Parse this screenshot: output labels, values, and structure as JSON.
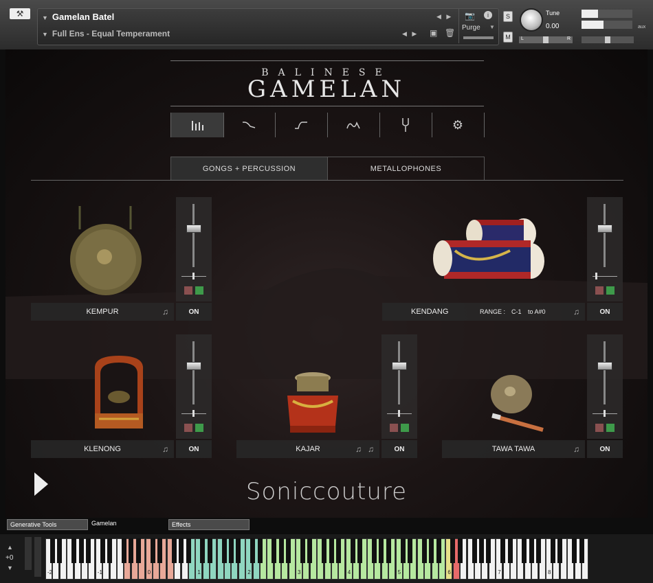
{
  "header": {
    "instrument_name": "Gamelan Batel",
    "snapshot_name": "Full Ens - Equal Temperament",
    "purge_label": "Purge",
    "tune_label": "Tune",
    "tune_value": "0.00",
    "solo_label": "S",
    "mute_label": "M",
    "pan_left": "L",
    "pan_right": "R",
    "aux_label": "aux"
  },
  "brand": {
    "subtitle": "BALINESE",
    "title": "GAMELAN",
    "logo": "Soniccouture"
  },
  "icon_tabs": [
    "mixer-icon",
    "envelope-decay-icon",
    "envelope-attack-icon",
    "eq-curve-icon",
    "tuning-fork-icon",
    "gear-icon"
  ],
  "section_tabs": [
    {
      "label": "GONGS + PERCUSSION",
      "active": true
    },
    {
      "label": "METALLOPHONES",
      "active": false
    }
  ],
  "instruments": [
    {
      "label": "KEMPUR",
      "on": "ON",
      "fader": 0.62
    },
    {
      "label": "KENDANG",
      "on": "ON",
      "fader": 0.62,
      "range_label": "RANGE :",
      "range_from": "C-1",
      "range_to": "to A#0"
    },
    {
      "label": "KLENONG",
      "on": "ON",
      "fader": 0.62
    },
    {
      "label": "KAJAR",
      "on": "ON",
      "fader": 0.62
    },
    {
      "label": "TAWA TAWA",
      "on": "ON",
      "fader": 0.62
    }
  ],
  "bottom_tabs": [
    "Generative Tools",
    "Gamelan",
    "Effects"
  ],
  "keyboard": {
    "octave_shift": "+0",
    "octave_labels": [
      "-2",
      "-1",
      "0",
      "1",
      "2",
      "3",
      "4",
      "5",
      "6",
      "7",
      "8"
    ],
    "colors": {
      "salmon": "#e8a898",
      "teal": "#8fd6c0",
      "lightgreen": "#b6e8a0",
      "yellow": "#e6e08a",
      "red": "#e86a6a"
    }
  }
}
